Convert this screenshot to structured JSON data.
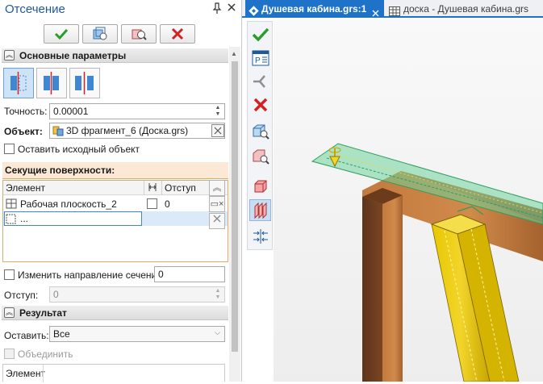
{
  "panel": {
    "title": "Отсечение",
    "pin_icon": "pin-icon",
    "close_icon": "close-icon"
  },
  "toolbar": {
    "ok_icon": "checkmark-icon",
    "preview_icon": "preview-icon",
    "zoom_icon": "zoom-icon",
    "cancel_icon": "cancel-icon"
  },
  "sections": {
    "main": "Основные параметры",
    "result": "Результат"
  },
  "form": {
    "precision_label": "Точность:",
    "precision_value": "0.00001",
    "object_label": "Объект:",
    "object_value": "3D фрагмент_6 (Доска.grs)",
    "keep_original_label": "Оставить исходный объект",
    "cutting_surfaces_label": "Секущие поверхности:",
    "reverse_direction_label": "Изменить направление сечения:",
    "reverse_direction_value": "0",
    "offset_label": "Отступ:",
    "offset_value": "0",
    "leave_label": "Оставить:",
    "leave_value": "Все",
    "merge_label": "Объединить",
    "element_label": "Элемент"
  },
  "table": {
    "col_element": "Элемент",
    "col_offset": "Отступ",
    "rows": [
      {
        "name": "Рабочая плоскость_2",
        "offset": "0"
      },
      {
        "name": "...",
        "offset": ""
      }
    ]
  },
  "tabs": [
    {
      "label": "Душевая кабина.grs:1",
      "active": true
    },
    {
      "label": "доска - Душевая кабина.grs",
      "active": false
    }
  ],
  "colors": {
    "accent": "#1e73c8",
    "wood": "#a0522d",
    "selection": "#f0d000",
    "plane": "#4cc07a"
  }
}
